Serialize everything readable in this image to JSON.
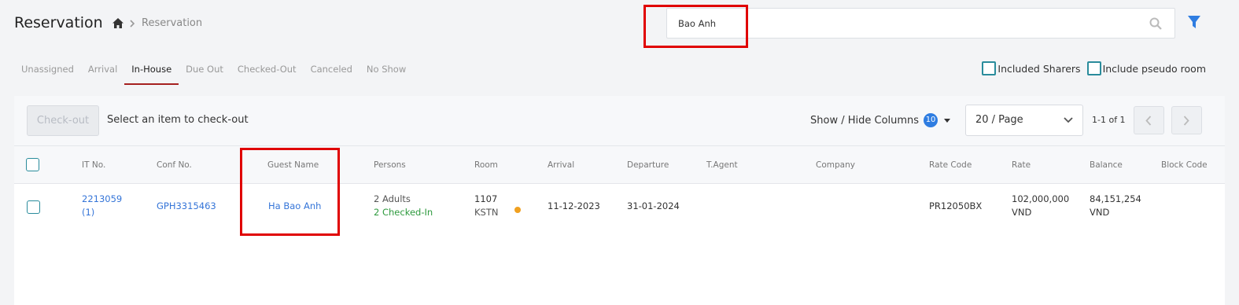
{
  "page": {
    "title": "Reservation"
  },
  "breadcrumb": {
    "current": "Reservation"
  },
  "search": {
    "value": "Bao Anh",
    "placeholder": ""
  },
  "tabs": [
    {
      "label": "Unassigned"
    },
    {
      "label": "Arrival"
    },
    {
      "label": "In-House",
      "active": true
    },
    {
      "label": "Due Out"
    },
    {
      "label": "Checked-Out"
    },
    {
      "label": "Canceled"
    },
    {
      "label": "No Show"
    }
  ],
  "options": {
    "included_sharers": "Included Sharers",
    "include_pseudo_room": "Include pseudo room"
  },
  "toolbar": {
    "checkout_label": "Check-out",
    "hint": "Select an item to check-out",
    "show_hide_label": "Show / Hide Columns",
    "column_count": "10",
    "page_size": "20 / Page",
    "page_info": "1-1 of 1"
  },
  "columns": {
    "it_no": "IT No.",
    "conf_no": "Conf No.",
    "guest_name": "Guest Name",
    "persons": "Persons",
    "room": "Room",
    "arrival": "Arrival",
    "departure": "Departure",
    "t_agent": "T.Agent",
    "company": "Company",
    "rate_code": "Rate Code",
    "rate": "Rate",
    "balance": "Balance",
    "block_code": "Block Code"
  },
  "rows": [
    {
      "it_no": "2213059",
      "it_no_sub": "(1)",
      "conf_no": "GPH3315463",
      "guest_name": "Ha Bao Anh",
      "persons": "2 Adults",
      "status": "2 Checked-In",
      "room": "1107",
      "room_type": "KSTN",
      "arrival": "11-12-2023",
      "departure": "31-01-2024",
      "t_agent": "",
      "company": "",
      "rate_code": "PR12050BX",
      "rate": "102,000,000",
      "rate_currency": "VND",
      "balance": "84,151,254",
      "balance_currency": "VND",
      "block_code": ""
    }
  ],
  "colors": {
    "accent": "#2f7de1",
    "active_tab": "#a52020",
    "link": "#3575d8",
    "checked_in": "#2e9a3e",
    "highlight": "#e00000",
    "room_status_dot": "#f0a020"
  }
}
